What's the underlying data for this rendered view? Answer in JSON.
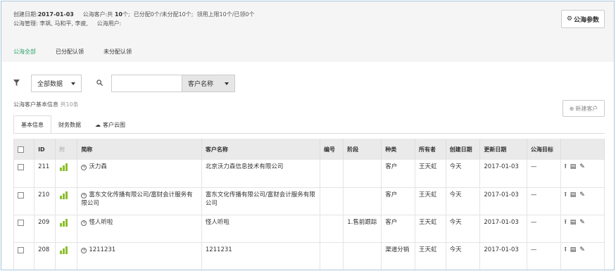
{
  "header": {
    "created_label": "创建日期:",
    "created_date": "2017-01-03",
    "sea_label": "公海客户:共",
    "sea_count": "10",
    "sea_unit": "个;",
    "assigned": "已分配0个/未分配10个;",
    "limit": "领用上限10个/已领0个",
    "managers": "公海管理: 李飒, 马和平, 李疲,",
    "users": "公海用户:",
    "params_button": "公海参数"
  },
  "top_tabs": [
    "公海全部",
    "已分配认领",
    "未分配认领"
  ],
  "filter": {
    "scope_select": "全部数据",
    "search_input": "",
    "field_select": "客户名称"
  },
  "basic_info": {
    "label": "公海客户基本信息",
    "count": "共10条"
  },
  "new_customer_button": "新建客户",
  "sub_tabs": [
    "基本信息",
    "财务数据",
    "客户云图"
  ],
  "table": {
    "headers": [
      "",
      "ID",
      "附",
      "简称",
      "客户名称",
      "编号",
      "阶段",
      "种类",
      "所有者",
      "创建日期",
      "更新日期",
      "公海目标",
      ""
    ],
    "rows": [
      {
        "id": "211",
        "short": "沃力森",
        "name": "北京沃力森信息技术有限公司",
        "code": "",
        "stage": "",
        "type": "客户",
        "owner": "王天虹",
        "created": "今天",
        "updated": "2017-01-03",
        "goal": "—"
      },
      {
        "id": "210",
        "short": "富东文化传播有限公司/富财会计服务有限公司",
        "name": "富东文化传播有限公司/富财会计服务有限公司",
        "code": "",
        "stage": "",
        "type": "客户",
        "owner": "王天虹",
        "created": "今天",
        "updated": "2017-01-03",
        "goal": "—"
      },
      {
        "id": "209",
        "short": "怪人听啦",
        "name": "怪人听啦",
        "code": "",
        "stage": "1.售前跟踪",
        "type": "客户",
        "owner": "王天虹",
        "created": "今天",
        "updated": "2017-01-03",
        "goal": "—"
      },
      {
        "id": "208",
        "short": "1211231",
        "name": "1211231",
        "code": "",
        "stage": "",
        "type": "渠道分销",
        "owner": "王天虹",
        "created": "今天",
        "updated": "2017-01-03",
        "goal": "—"
      }
    ]
  },
  "colors": {
    "accent": "#2aa36b",
    "file_icon": "#8dbf2e",
    "frame_border": "#a9c4dc"
  }
}
